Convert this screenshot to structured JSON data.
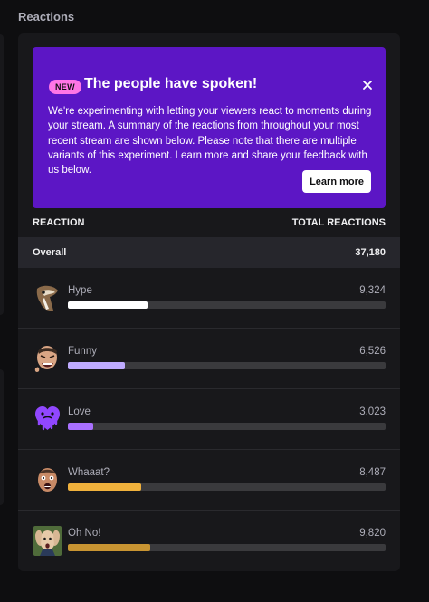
{
  "section": {
    "title": "Reactions"
  },
  "banner": {
    "badge": "NEW",
    "title": "The people have spoken!",
    "body": "We're experimenting with letting your viewers react to moments during your stream. A summary of the reactions from throughout your most recent stream are shown below. Please note that there are multiple variants of this experiment. Learn more and share your feedback with us below.",
    "learn_more_label": "Learn more",
    "close_icon": "close-icon",
    "bg_color": "#5c16c5",
    "badge_color": "#ff75e6"
  },
  "table": {
    "col_reaction": "REACTION",
    "col_total": "TOTAL REACTIONS",
    "overall_label": "Overall",
    "overall_total": "37,180"
  },
  "reactions": [
    {
      "name": "Hype",
      "count": "9,324",
      "fill_fraction": 0.25,
      "color": "#ffffff",
      "icon": "hype-emote-icon"
    },
    {
      "name": "Funny",
      "count": "6,526",
      "fill_fraction": 0.18,
      "color": "#bfabff",
      "icon": "funny-emote-icon"
    },
    {
      "name": "Love",
      "count": "3,023",
      "fill_fraction": 0.08,
      "color": "#a970ff",
      "icon": "love-emote-icon"
    },
    {
      "name": "Whaaat?",
      "count": "8,487",
      "fill_fraction": 0.23,
      "color": "#f0b13c",
      "icon": "whaaat-emote-icon"
    },
    {
      "name": "Oh No!",
      "count": "9,820",
      "fill_fraction": 0.26,
      "color": "#c89432",
      "icon": "oh-no-emote-icon"
    }
  ]
}
